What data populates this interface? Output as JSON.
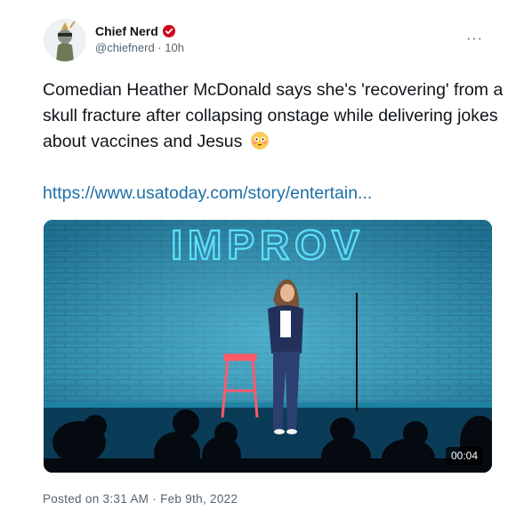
{
  "tweet": {
    "author_name": "Chief Nerd",
    "author_handle": "@chiefnerd",
    "time_ago": "10h",
    "meta_separator": " · ",
    "text": "Comedian Heather McDonald says she's 'recovering' from a skull fracture after collapsing onstage while delivering jokes about vaccines and Jesus",
    "emoji": "flushed-face",
    "link_text": "https://www.usatoday.com/story/entertain...",
    "more_label": "···",
    "posted_on": "Posted on 3:31 AM · Feb 9th, 2022"
  },
  "media": {
    "sign_text": "IMPROV",
    "duration": "00:04"
  },
  "colors": {
    "verified": "#d0021b",
    "link": "#1d6fa5",
    "secondary_text": "#536471",
    "neon_sign": "#5ee0ff"
  }
}
